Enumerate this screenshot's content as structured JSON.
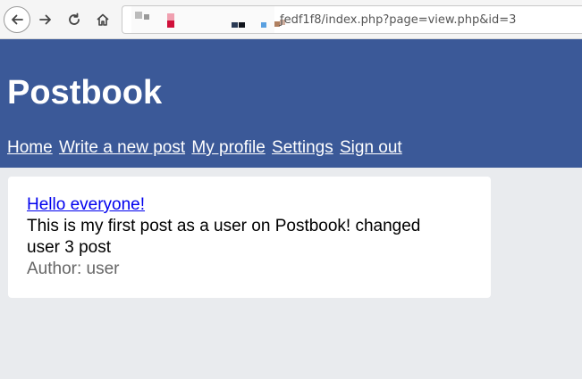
{
  "browser": {
    "url_visible": "ƒedf1f8/index.php?page=view.php&id=3",
    "icons": {
      "back": "back-arrow-icon",
      "forward": "forward-arrow-icon",
      "reload": "reload-icon",
      "home": "home-icon"
    }
  },
  "header": {
    "title": "Postbook",
    "nav": [
      {
        "label": "Home"
      },
      {
        "label": "Write a new post"
      },
      {
        "label": "My profile"
      },
      {
        "label": "Settings"
      },
      {
        "label": "Sign out"
      }
    ]
  },
  "post": {
    "title": "Hello everyone!",
    "body": "This is my first post as a user on Postbook! changed user 3 post",
    "author": "Author: user"
  },
  "colors": {
    "header_bg": "#3b5998",
    "page_bg": "#e9ebee",
    "link": "#0000ee",
    "author_text": "#666666"
  }
}
